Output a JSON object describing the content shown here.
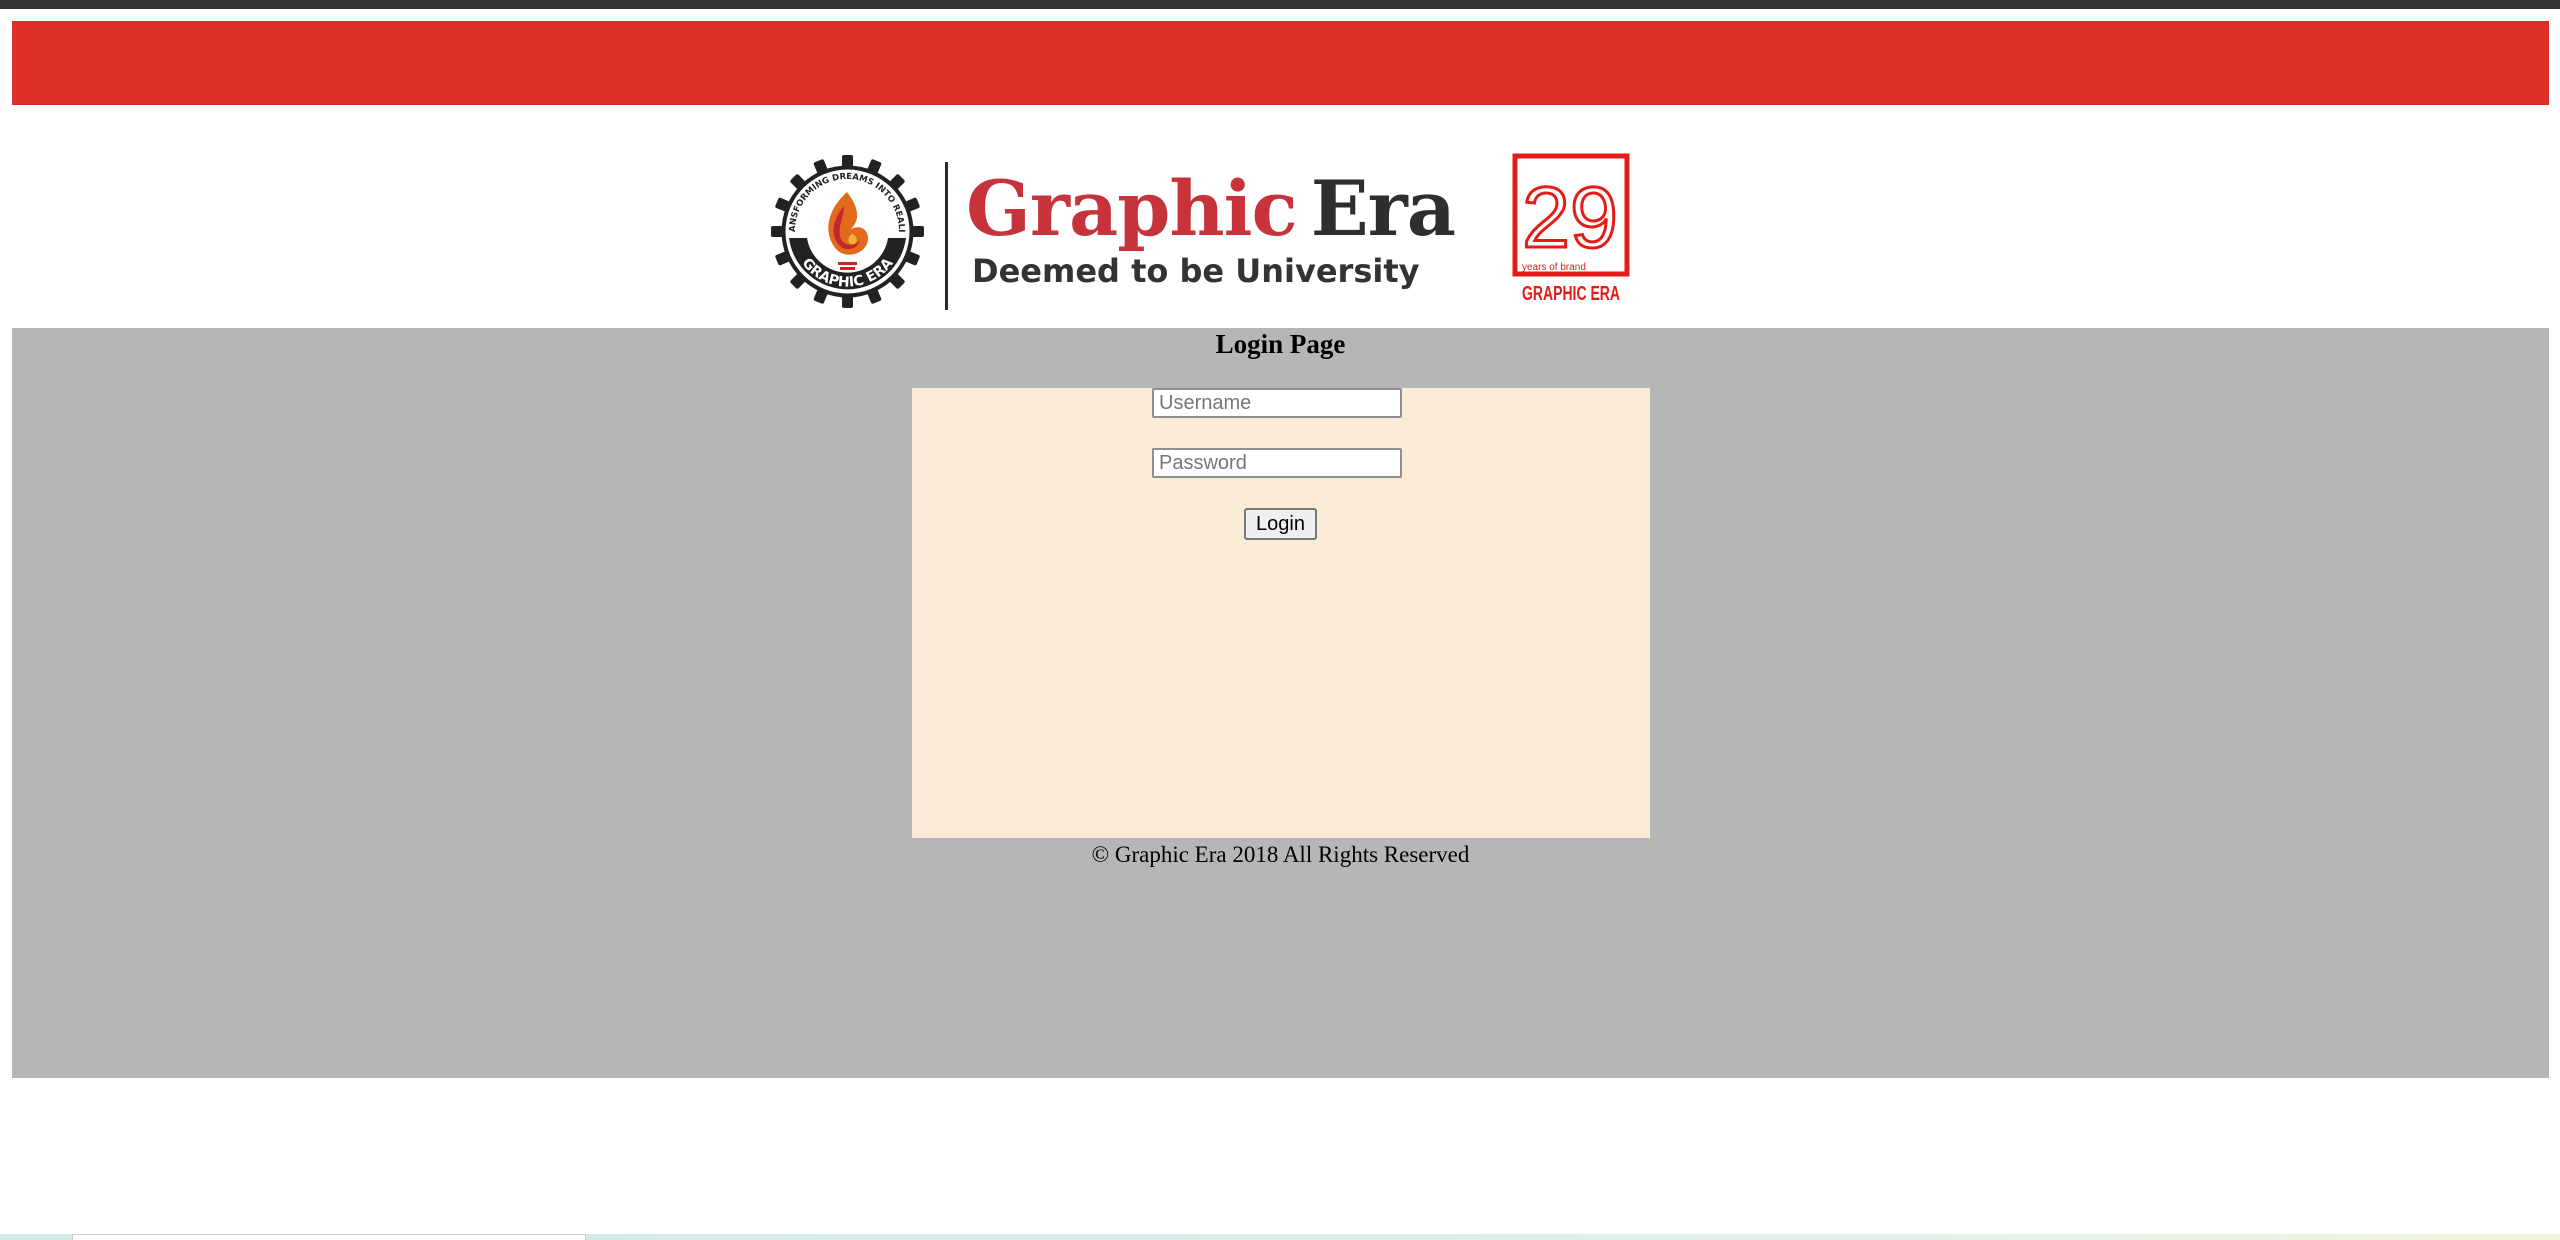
{
  "header": {
    "brand_primary": "Graphic",
    "brand_secondary": "Era",
    "tagline": "Deemed to be University",
    "seal_text_top": "TRANSFORMING DREAMS INTO REALITY",
    "seal_text_bottom": "GRAPHIC ERA",
    "anniversary_number": "29",
    "anniversary_caption": "years of brand",
    "anniversary_brand": "GRAPHIC ERA",
    "colors": {
      "brand_red": "#dd2e27",
      "brand_dark": "#2e2e2e"
    }
  },
  "login": {
    "title": "Login Page",
    "username_placeholder": "Username",
    "password_placeholder": "Password",
    "button_label": "Login"
  },
  "footer": {
    "copyright": "© Graphic Era 2018 All Rights Reserved"
  },
  "colors": {
    "panel": "#b6b6b6",
    "form_box": "#faebd7"
  }
}
